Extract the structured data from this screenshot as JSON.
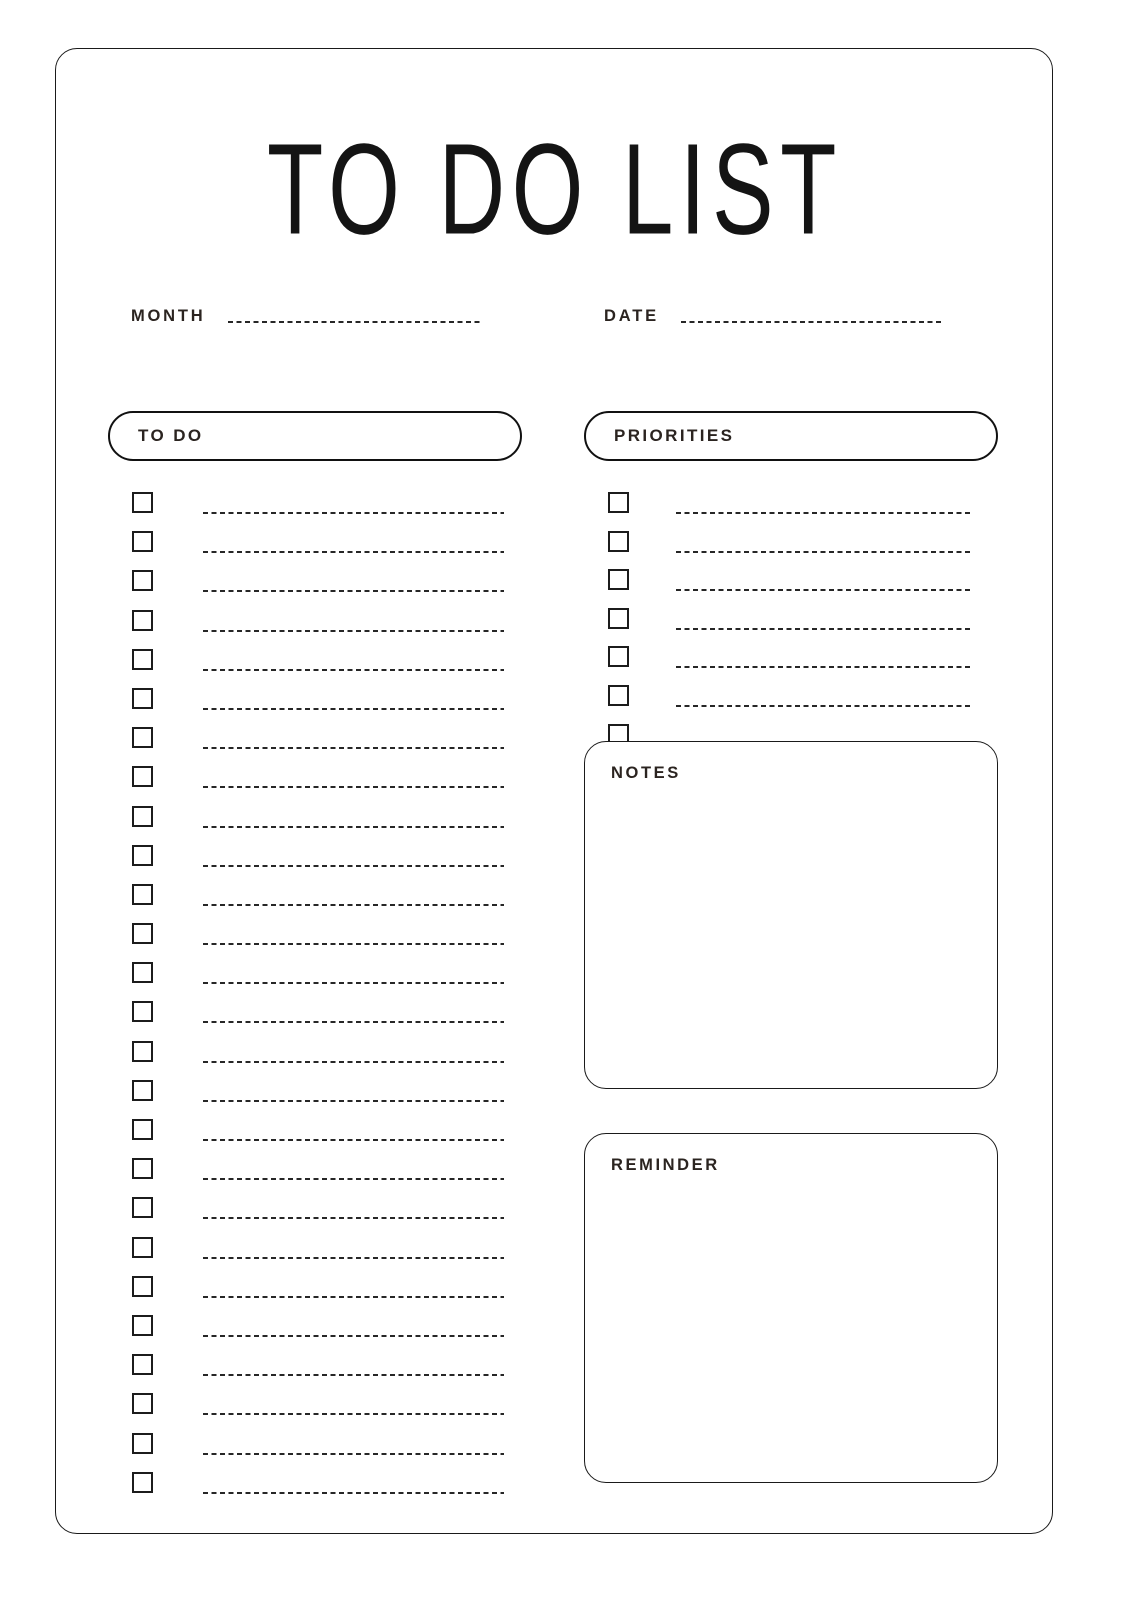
{
  "document": {
    "title": "TO DO LIST",
    "page_type": "printable-planner"
  },
  "meta": {
    "month": {
      "label": "MONTH",
      "value": "",
      "placeholder": ""
    },
    "date": {
      "label": "DATE",
      "value": "",
      "placeholder": ""
    }
  },
  "sections": {
    "todo": {
      "header": "TO DO",
      "row_count": 26,
      "items": [
        "",
        "",
        "",
        "",
        "",
        "",
        "",
        "",
        "",
        "",
        "",
        "",
        "",
        "",
        "",
        "",
        "",
        "",
        "",
        "",
        "",
        "",
        "",
        "",
        "",
        ""
      ]
    },
    "priorities": {
      "header": "PRIORITIES",
      "row_count": 7,
      "items": [
        "",
        "",
        "",
        "",
        "",
        "",
        ""
      ]
    },
    "notes": {
      "header": "NOTES",
      "value": ""
    },
    "reminder": {
      "header": "REMINDER",
      "value": ""
    }
  },
  "style": {
    "ink": "#1a1a1a",
    "label_ink": "#2b2420",
    "paper": "#ffffff",
    "rule_style": "dashed"
  }
}
